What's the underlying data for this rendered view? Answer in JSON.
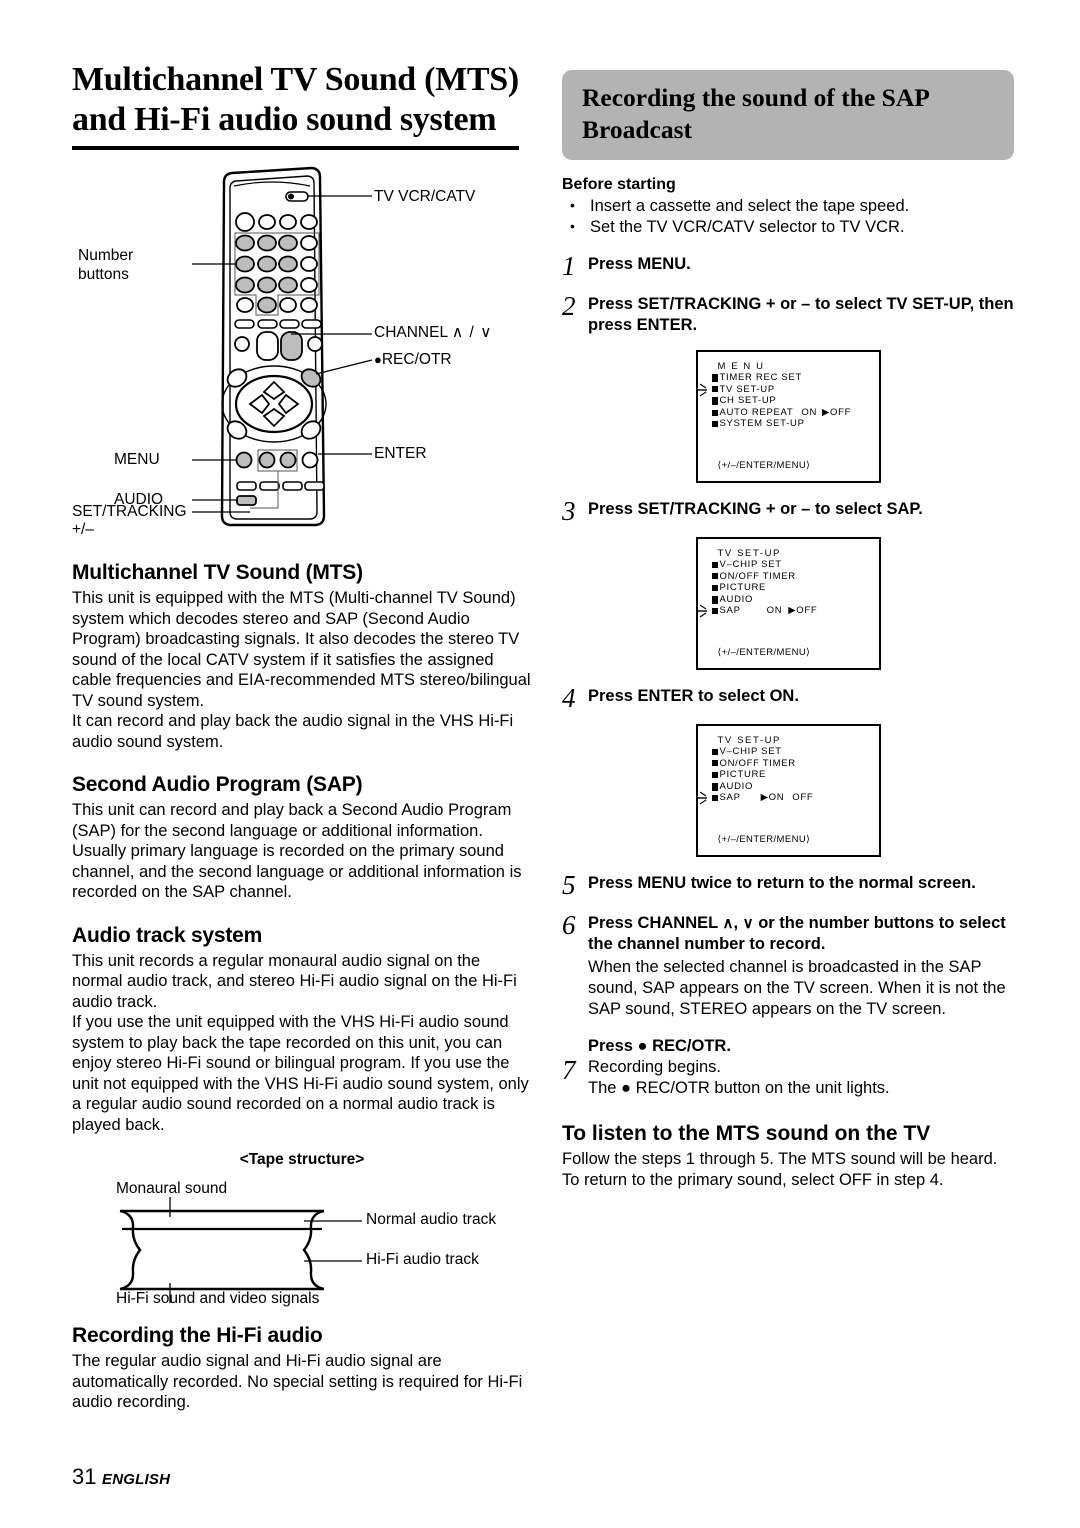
{
  "left": {
    "title": "Multichannel TV Sound (MTS) and Hi-Fi audio sound system",
    "remote_labels": {
      "tv_vcr_catv": "TV VCR/CATV",
      "number_buttons_line1": "Number",
      "number_buttons_line2": "buttons",
      "channel": "CHANNEL",
      "channel_arrows": "∧ / ∨",
      "rec_otr": "REC/OTR",
      "menu": "MENU",
      "enter": "ENTER",
      "audio": "AUDIO",
      "set_tracking": "SET/TRACKING",
      "set_tracking_plus_minus": "+/–"
    },
    "sections": [
      {
        "heading": "Multichannel TV Sound (MTS)",
        "paragraphs": [
          "This unit is equipped with the MTS (Multi-channel TV Sound) system which decodes stereo and SAP (Second Audio Program) broadcasting signals. It also decodes the stereo TV sound of the local CATV system if it satisfies the assigned cable frequencies and EIA-recommended MTS stereo/bilingual TV sound system.",
          "It can record and play back the audio signal in the VHS Hi-Fi audio sound system."
        ]
      },
      {
        "heading": "Second Audio Program (SAP)",
        "paragraphs": [
          "This unit can record and play back a Second Audio Program (SAP) for the second language or additional information. Usually primary language is recorded on the primary sound channel, and the second language or additional information is recorded on the SAP channel."
        ]
      },
      {
        "heading": "Audio track system",
        "paragraphs": [
          "This unit records a regular monaural audio signal on the normal audio track, and stereo Hi-Fi audio signal on the Hi-Fi audio track.",
          "If you use the unit equipped with the VHS Hi-Fi audio sound system to play back the tape recorded on this unit, you can enjoy stereo Hi-Fi sound or bilingual program. If you use the unit not equipped with the VHS Hi-Fi audio sound system, only a regular audio sound recorded on a normal audio track is played back."
        ]
      }
    ],
    "tape": {
      "title": "<Tape structure>",
      "monaural": "Monaural sound",
      "normal_track": "Normal audio track",
      "hifi_track": "Hi-Fi audio track",
      "bottom": "Hi-Fi sound and video signals"
    },
    "hifi_section": {
      "heading": "Recording the Hi-Fi audio",
      "paragraph": "The regular audio signal and Hi-Fi audio signal are automatically recorded. No special setting is required for Hi-Fi audio recording."
    },
    "footer": {
      "page": "31",
      "language": "ENGLISH"
    }
  },
  "right": {
    "banner_title": "Recording the sound of the SAP Broadcast",
    "before_heading": "Before starting",
    "before_items": [
      "Insert a cassette and select the tape speed.",
      "Set the TV VCR/CATV selector to TV VCR."
    ],
    "steps": {
      "s1_num": "1",
      "s1_text": "Press MENU.",
      "s2_num": "2",
      "s2_text": "Press SET/TRACKING + or – to select TV SET-UP, then press ENTER.",
      "s3_num": "3",
      "s3_text": "Press SET/TRACKING + or – to select SAP.",
      "s4_num": "4",
      "s4_text": "Press ENTER to select ON.",
      "s5_num": "5",
      "s5_text": "Press MENU twice to return to the normal screen.",
      "s6_num": "6",
      "s6_text_a": "Press CHANNEL ",
      "s6_text_b": ", ",
      "s6_text_c": " or the number buttons to select the channel number to record.",
      "s6_note": "When the selected channel is broadcasted in the SAP sound, SAP appears on the TV screen. When it is not the SAP sound, STEREO appears on the TV screen.",
      "s7_num": "7",
      "s7_bold": "Press ● REC/OTR.",
      "s7_line1": "Recording begins.",
      "s7_line2": "The ● REC/OTR button on the unit lights."
    },
    "screens": {
      "menu": {
        "header": "M E N U",
        "rows": [
          "TIMER REC SET",
          "TV SET-UP",
          "CH SET-UP",
          "AUTO REPEAT",
          "SYSTEM SET-UP"
        ],
        "auto_repeat_on": "ON",
        "auto_repeat_off": "OFF",
        "footer": "⟨+/–/ENTER/MENU⟩"
      },
      "tvsetup_off": {
        "header": "TV SET-UP",
        "rows": [
          "V–CHIP SET",
          "ON/OFF TIMER",
          "PICTURE",
          "AUDIO",
          "SAP"
        ],
        "sap_on": "ON",
        "sap_off": "OFF",
        "selected": "OFF",
        "footer": "⟨+/–/ENTER/MENU⟩"
      },
      "tvsetup_on": {
        "header": "TV SET-UP",
        "rows": [
          "V–CHIP SET",
          "ON/OFF TIMER",
          "PICTURE",
          "AUDIO",
          "SAP"
        ],
        "sap_on": "ON",
        "sap_off": "OFF",
        "selected": "ON",
        "footer": "⟨+/–/ENTER/MENU⟩"
      }
    },
    "mts_section": {
      "heading": "To listen to the MTS sound on the TV",
      "paragraph": "Follow the steps 1 through 5. The MTS sound will be heard. To return to the primary sound, select OFF in step 4."
    }
  }
}
